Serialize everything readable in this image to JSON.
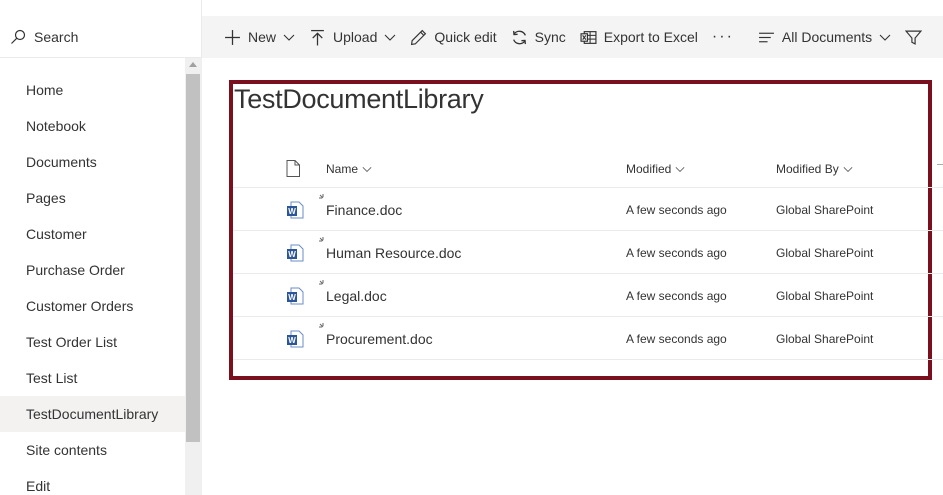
{
  "search": {
    "label": "Search"
  },
  "nav": {
    "items": [
      {
        "label": "Home"
      },
      {
        "label": "Notebook"
      },
      {
        "label": "Documents"
      },
      {
        "label": "Pages"
      },
      {
        "label": "Customer"
      },
      {
        "label": "Purchase Order"
      },
      {
        "label": "Customer Orders"
      },
      {
        "label": "Test Order List"
      },
      {
        "label": "Test List"
      },
      {
        "label": "TestDocumentLibrary",
        "selected": true
      },
      {
        "label": "Site contents"
      },
      {
        "label": "Edit"
      }
    ]
  },
  "toolbar": {
    "new_label": "New",
    "upload_label": "Upload",
    "quick_edit_label": "Quick edit",
    "sync_label": "Sync",
    "export_label": "Export to Excel",
    "more_label": "···",
    "view_label": "All Documents"
  },
  "library": {
    "title": "TestDocumentLibrary",
    "columns": {
      "name": "Name",
      "modified": "Modified",
      "modified_by": "Modified By"
    },
    "files": [
      {
        "name": "Finance.doc",
        "modified": "A few seconds ago",
        "modified_by": "Global SharePoint",
        "icon": "word-doc-icon"
      },
      {
        "name": "Human Resource.doc",
        "modified": "A few seconds ago",
        "modified_by": "Global SharePoint",
        "icon": "word-doc-icon"
      },
      {
        "name": "Legal.doc",
        "modified": "A few seconds ago",
        "modified_by": "Global SharePoint",
        "icon": "word-doc-icon"
      },
      {
        "name": "Procurement.doc",
        "modified": "A few seconds ago",
        "modified_by": "Global SharePoint",
        "icon": "word-doc-icon"
      }
    ]
  },
  "colors": {
    "highlight_frame": "#7a0f1e",
    "word_blue": "#2b579a",
    "command_bar_bg": "#f4f4f4"
  }
}
